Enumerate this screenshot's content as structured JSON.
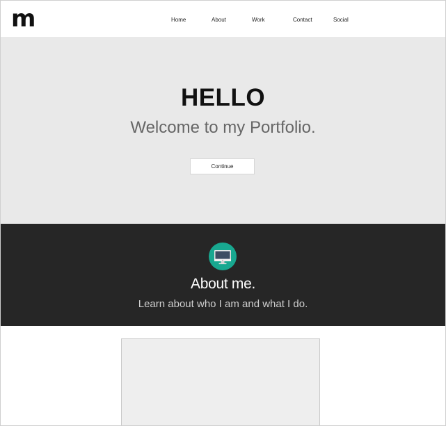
{
  "header": {
    "logo_text": "m",
    "nav": {
      "home": "Home",
      "about": "About",
      "work": "Work",
      "contact": "Contact",
      "social": "Social"
    }
  },
  "hero": {
    "title": "HELLO",
    "subtitle": "Welcome to my Portfolio.",
    "button_label": "Continue"
  },
  "about": {
    "icon": "monitor-icon",
    "icon_bg_color": "#18a890",
    "title": "About me.",
    "subtitle": "Learn about who I am and what I do."
  },
  "colors": {
    "hero_bg": "#e9e9e9",
    "about_bg": "#262626",
    "accent": "#18a890"
  }
}
